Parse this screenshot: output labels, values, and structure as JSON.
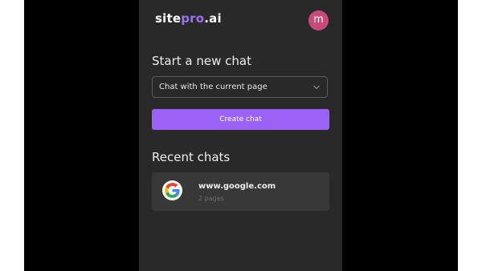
{
  "app": {
    "brand_prefix": "site",
    "brand_accent": "pro",
    "brand_suffix": ".ai",
    "brand_accent_color": "#9b72f2"
  },
  "user": {
    "avatar_initial": "m",
    "avatar_color": "#c94a7a"
  },
  "new_chat": {
    "heading": "Start a new chat",
    "select_value": "Chat with the current page",
    "select_icon": "chevron-down-icon",
    "create_label": "Create chat",
    "button_color": "#9b63f5"
  },
  "recent": {
    "heading": "Recent chats",
    "items": [
      {
        "icon": "google-g-icon",
        "domain": "www.google.com",
        "pages": "2 pages"
      }
    ]
  }
}
